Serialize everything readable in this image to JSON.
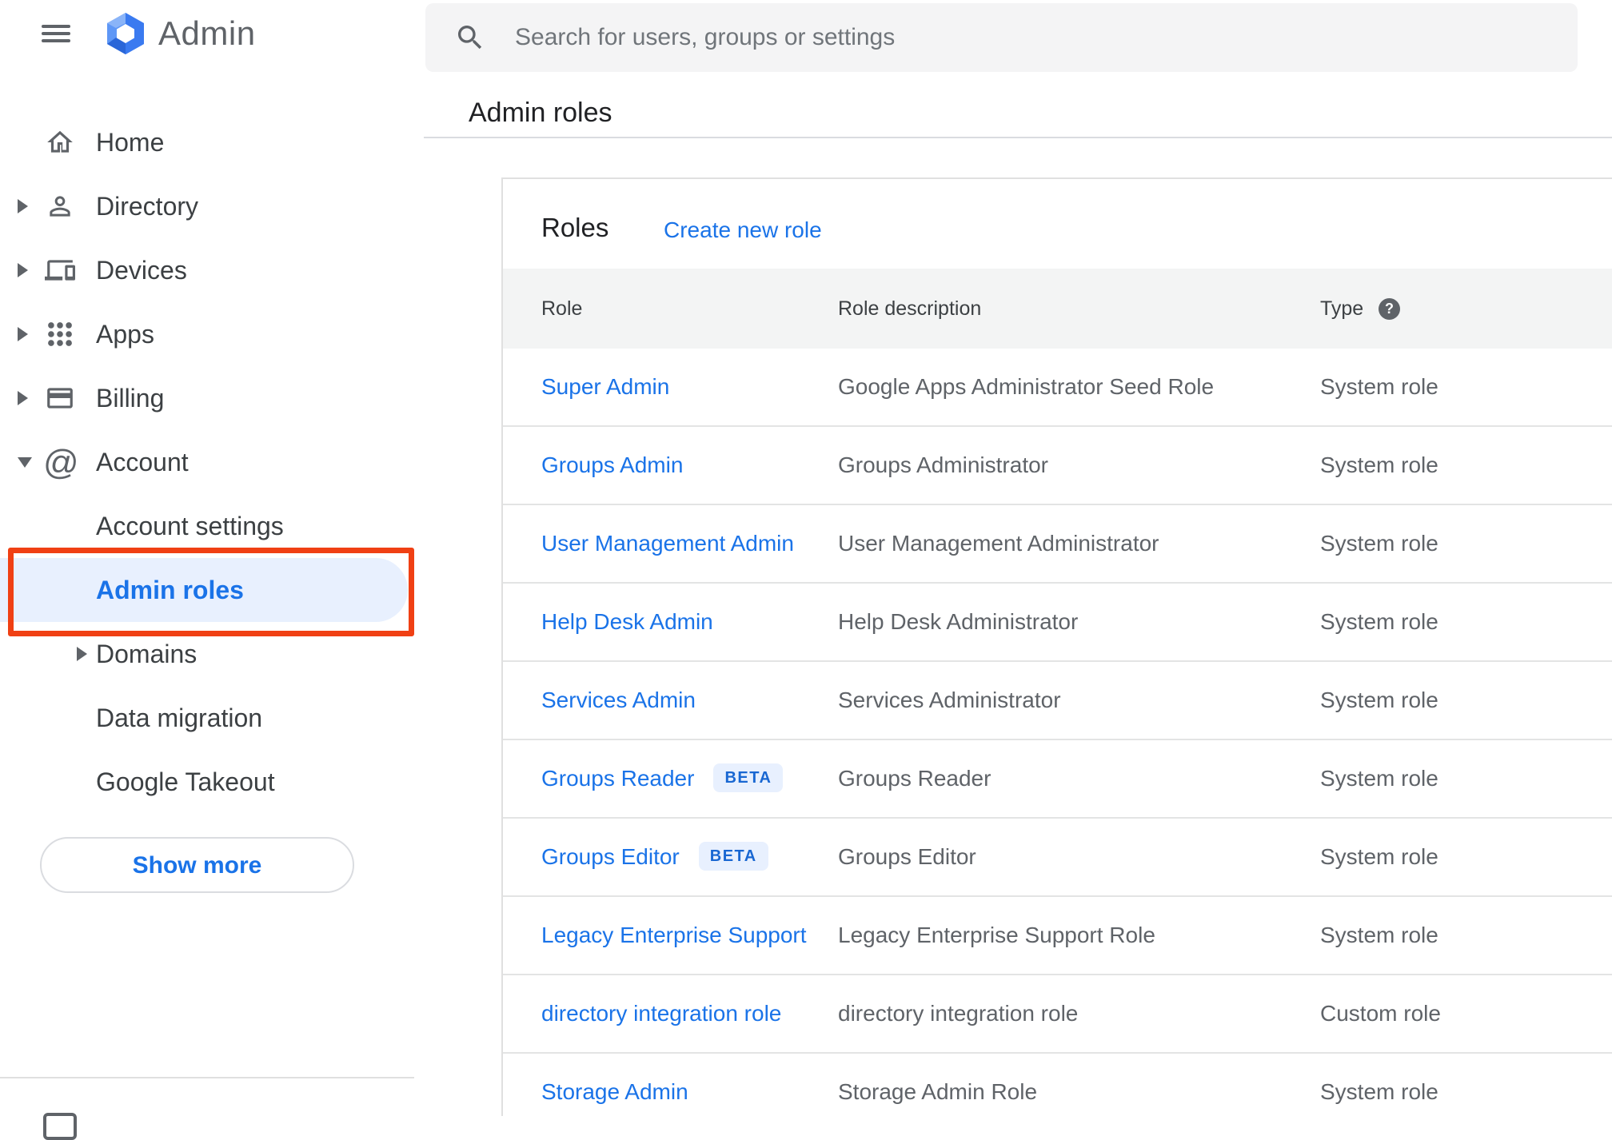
{
  "header": {
    "app_name": "Admin",
    "search_placeholder": "Search for users, groups or settings",
    "breadcrumb": "Admin roles"
  },
  "sidebar": {
    "items": [
      {
        "label": "Home",
        "type": "top",
        "icon": "home-icon",
        "arrow": "none",
        "selected": false
      },
      {
        "label": "Directory",
        "type": "top",
        "icon": "person-icon",
        "arrow": "right",
        "selected": false
      },
      {
        "label": "Devices",
        "type": "top",
        "icon": "devices-icon",
        "arrow": "right",
        "selected": false
      },
      {
        "label": "Apps",
        "type": "top",
        "icon": "apps-icon",
        "arrow": "right",
        "selected": false
      },
      {
        "label": "Billing",
        "type": "top",
        "icon": "card-icon",
        "arrow": "right",
        "selected": false
      },
      {
        "label": "Account",
        "type": "top",
        "icon": "at-icon",
        "arrow": "down",
        "selected": false
      },
      {
        "label": "Account settings",
        "type": "sub",
        "icon": "none",
        "arrow": "none",
        "selected": false
      },
      {
        "label": "Admin roles",
        "type": "sub",
        "icon": "none",
        "arrow": "none",
        "selected": true,
        "annotated": true
      },
      {
        "label": "Domains",
        "type": "sub",
        "icon": "none",
        "arrow": "right",
        "selected": false
      },
      {
        "label": "Data migration",
        "type": "sub",
        "icon": "none",
        "arrow": "none",
        "selected": false
      },
      {
        "label": "Google Takeout",
        "type": "sub",
        "icon": "none",
        "arrow": "none",
        "selected": false
      }
    ],
    "show_more_label": "Show more"
  },
  "content": {
    "title": "Roles",
    "create_link": "Create new role",
    "beta_label": "BETA",
    "columns": [
      "Role",
      "Role description",
      "Type"
    ],
    "rows": [
      {
        "role": "Super Admin",
        "beta": false,
        "description": "Google Apps Administrator Seed Role",
        "type": "System role"
      },
      {
        "role": "Groups Admin",
        "beta": false,
        "description": "Groups Administrator",
        "type": "System role"
      },
      {
        "role": "User Management Admin",
        "beta": false,
        "description": "User Management Administrator",
        "type": "System role"
      },
      {
        "role": "Help Desk Admin",
        "beta": false,
        "description": "Help Desk Administrator",
        "type": "System role"
      },
      {
        "role": "Services Admin",
        "beta": false,
        "description": "Services Administrator",
        "type": "System role"
      },
      {
        "role": "Groups Reader",
        "beta": true,
        "description": "Groups Reader",
        "type": "System role"
      },
      {
        "role": "Groups Editor",
        "beta": true,
        "description": "Groups Editor",
        "type": "System role"
      },
      {
        "role": "Legacy Enterprise Support",
        "beta": false,
        "description": "Legacy Enterprise Support Role",
        "type": "System role"
      },
      {
        "role": "directory integration role",
        "beta": false,
        "description": "directory integration role",
        "type": "Custom role"
      },
      {
        "role": "Storage Admin",
        "beta": false,
        "description": "Storage Admin Role",
        "type": "System role"
      }
    ]
  },
  "colors": {
    "accent_blue": "#1a73e8",
    "selected_item_bg": "#e8f0fe",
    "annotation_red": "#f04014",
    "beta_badge_bg": "#e8f0fe",
    "beta_badge_text": "#1967d2",
    "table_header_bg": "#f3f4f4",
    "icon_gray": "#5f6368"
  }
}
